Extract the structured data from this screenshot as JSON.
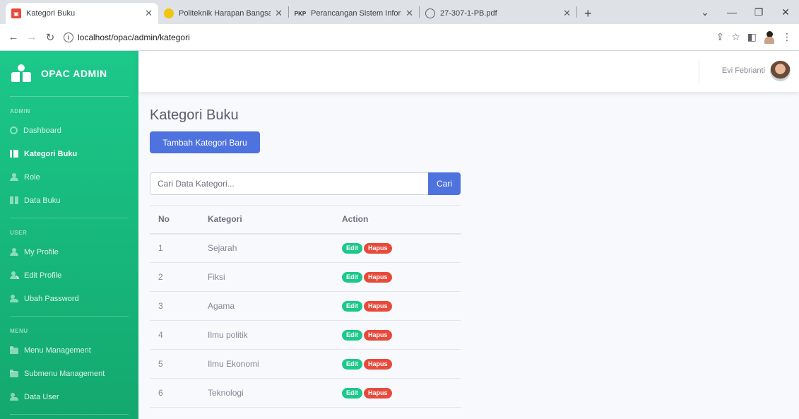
{
  "browser": {
    "tabs": [
      {
        "title": "Kategori Buku",
        "active": true
      },
      {
        "title": "Politeknik Harapan Bangsa Surak",
        "active": false
      },
      {
        "title": "Perancangan Sistem Informasi Pe",
        "active": false
      },
      {
        "title": "27-307-1-PB.pdf",
        "active": false
      }
    ],
    "favicon_pkp": "PKP",
    "url": "localhost/opac/admin/kategori"
  },
  "sidebar": {
    "brand": "OPAC ADMIN",
    "sections": [
      {
        "heading": "ADMIN",
        "items": [
          {
            "label": "Dashboard",
            "icon": "gauge-icon",
            "active": false
          },
          {
            "label": "Kategori Buku",
            "icon": "books-icon",
            "active": true
          },
          {
            "label": "Role",
            "icon": "user-icon",
            "active": false
          },
          {
            "label": "Data Buku",
            "icon": "book-icon",
            "active": false
          }
        ]
      },
      {
        "heading": "USER",
        "items": [
          {
            "label": "My Profile",
            "icon": "user-icon",
            "active": false
          },
          {
            "label": "Edit Profile",
            "icon": "user-edit-icon",
            "active": false
          },
          {
            "label": "Ubah Password",
            "icon": "user-key-icon",
            "active": false
          }
        ]
      },
      {
        "heading": "MENU",
        "items": [
          {
            "label": "Menu Management",
            "icon": "folder-icon",
            "active": false
          },
          {
            "label": "Submenu Management",
            "icon": "folder-open-icon",
            "active": false
          },
          {
            "label": "Data User",
            "icon": "users-icon",
            "active": false
          }
        ]
      }
    ]
  },
  "topbar": {
    "username": "Evi Febrianti"
  },
  "main": {
    "title": "Kategori Buku",
    "add_button": "Tambah Kategori Baru",
    "search": {
      "placeholder": "Cari Data Kategori...",
      "value": "",
      "button": "Cari"
    },
    "table": {
      "headers": [
        "No",
        "Kategori",
        "Action"
      ],
      "rows": [
        {
          "no": "1",
          "kategori": "Sejarah"
        },
        {
          "no": "2",
          "kategori": "Fiksi"
        },
        {
          "no": "3",
          "kategori": "Agama"
        },
        {
          "no": "4",
          "kategori": "Ilmu politik"
        },
        {
          "no": "5",
          "kategori": "Ilmu Ekonomi"
        },
        {
          "no": "6",
          "kategori": "Teknologi"
        }
      ],
      "edit_label": "Edit",
      "delete_label": "Hapus"
    }
  },
  "colors": {
    "sidebar": "#1cc88a",
    "primary": "#4e73df",
    "success": "#1cc88a",
    "danger": "#e74a3b"
  }
}
